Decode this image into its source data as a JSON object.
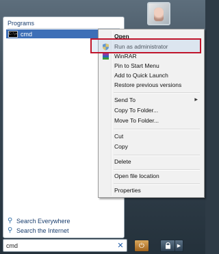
{
  "start_menu": {
    "programs_header": "Programs",
    "program_item": "cmd",
    "cmd_icon_text": "C:\\>",
    "search_everywhere": "Search Everywhere",
    "search_internet": "Search the Internet",
    "search_value": "cmd"
  },
  "context_menu": {
    "items": [
      {
        "label": "Open"
      },
      {
        "label": "Run as administrator"
      },
      {
        "label": "WinRAR"
      },
      {
        "label": "Pin to Start Menu"
      },
      {
        "label": "Add to Quick Launch"
      },
      {
        "label": "Restore previous versions"
      },
      {
        "label": "Send To"
      },
      {
        "label": "Copy To Folder..."
      },
      {
        "label": "Move To Folder..."
      },
      {
        "label": "Cut"
      },
      {
        "label": "Copy"
      },
      {
        "label": "Delete"
      },
      {
        "label": "Open file location"
      },
      {
        "label": "Properties"
      }
    ]
  },
  "icons": {
    "search": "magnifier-icon",
    "shield": "uac-shield-icon",
    "winrar": "winrar-icon",
    "power": "power-icon",
    "lock": "lock-icon",
    "arrow": "chevron-right-icon",
    "clear": "clear-search-icon"
  },
  "colors": {
    "highlight_border": "#c0152b",
    "selected_program_bg": "#3d6fb7",
    "menu_bg": "#f1f1f1"
  }
}
